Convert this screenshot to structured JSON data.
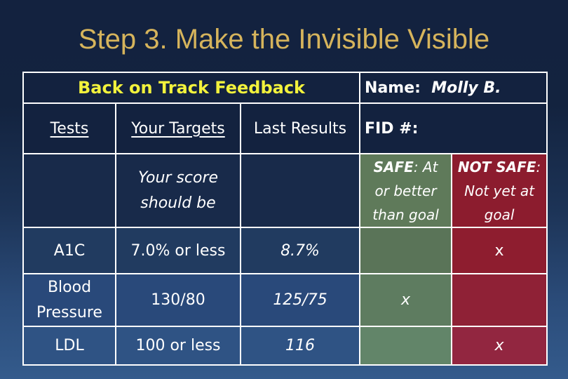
{
  "slide": {
    "title": "Step 3. Make the Invisible Visible"
  },
  "card": {
    "heading": "Back on Track Feedback",
    "name_label": "Name:",
    "name_value": "Molly B.",
    "columns": {
      "tests": "Tests",
      "targets": "Your Targets",
      "last_results": "Last Results",
      "fid": "FID #:"
    },
    "subheader": {
      "targets_note_line1": "Your score",
      "targets_note_line2": "should be",
      "safe_label": "SAFE",
      "safe_text_1": ": At",
      "safe_text_2": "or better",
      "safe_text_3": "than goal",
      "notsafe_label": "NOT SAFE",
      "notsafe_text_1": ":",
      "notsafe_text_2": "Not yet at",
      "notsafe_text_3": "goal"
    },
    "rows": [
      {
        "test": "A1C",
        "target": "7.0% or less",
        "result": "8.7%",
        "safe": "",
        "not_safe": "x"
      },
      {
        "test_line1": "Blood",
        "test_line2": "Pressure",
        "target": "130/80",
        "result": "125/75",
        "safe": "x",
        "not_safe": ""
      },
      {
        "test": "LDL",
        "target": "100 or less",
        "result": "116",
        "safe": "",
        "not_safe": "x"
      }
    ]
  },
  "colors": {
    "title": "#d6b45c",
    "heading": "#f2f23c",
    "safe": "#5f7a5a",
    "not_safe": "#8c1c2e",
    "background_top": "#13223f",
    "background_bottom": "#345b8c"
  }
}
